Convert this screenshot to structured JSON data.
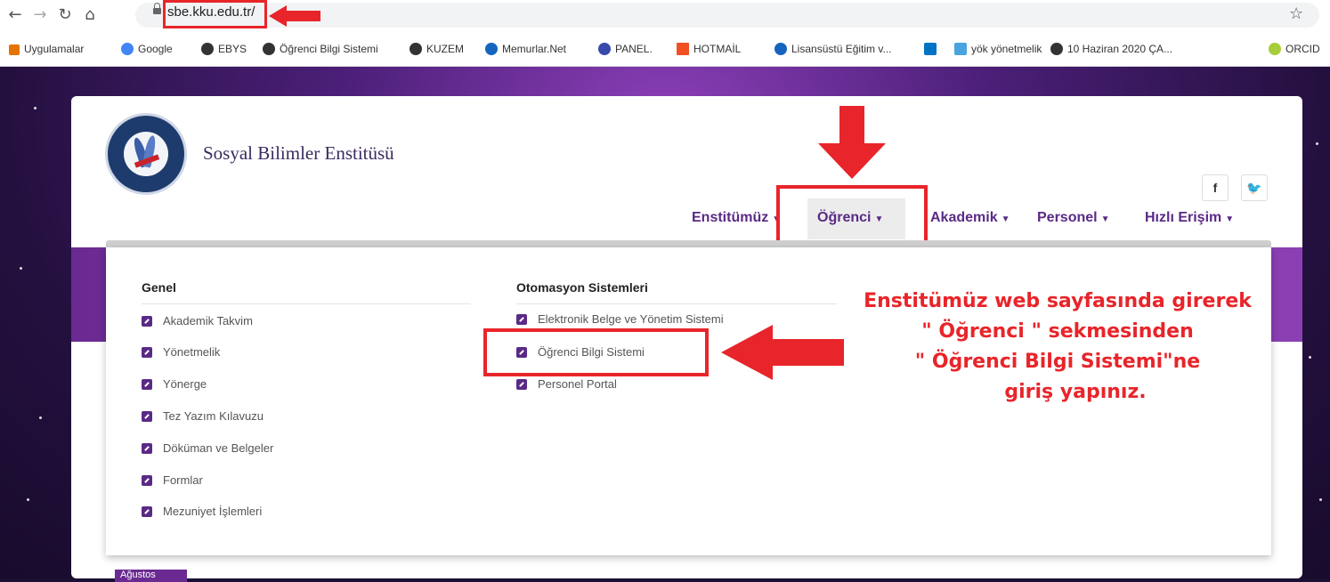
{
  "browser": {
    "url": "sbe.kku.edu.tr/",
    "bookmarks": [
      {
        "label": "Uygulamalar",
        "icon": "apps-grid-icon",
        "color": "#e37400"
      },
      {
        "label": "Google",
        "icon": "google-icon",
        "color": "#4285f4"
      },
      {
        "label": "EBYS",
        "icon": "globe-icon",
        "color": "#333333"
      },
      {
        "label": "Öğrenci Bilgi Sistemi",
        "icon": "globe-icon",
        "color": "#333333"
      },
      {
        "label": "KUZEM",
        "icon": "globe-icon",
        "color": "#333333"
      },
      {
        "label": "Memurlar.Net",
        "icon": "memurlar-icon",
        "color": "#1565c0"
      },
      {
        "label": "PANEL.",
        "icon": "panel-icon",
        "color": "#3949ab"
      },
      {
        "label": "HOTMAİL",
        "icon": "windows-icon",
        "color": "#f25022"
      },
      {
        "label": "Lisansüstü Eğitim v...",
        "icon": "memurlar-icon",
        "color": "#1565c0"
      },
      {
        "label": "",
        "icon": "outlook-icon",
        "color": "#0072c6"
      },
      {
        "label": "yök yönetmelik",
        "icon": "doc-icon",
        "color": "#4aa3df"
      },
      {
        "label": "10 Haziran 2020 ÇA...",
        "icon": "globe-icon",
        "color": "#333333"
      },
      {
        "label": "ORCID",
        "icon": "orcid-icon",
        "color": "#a6ce39"
      }
    ]
  },
  "site": {
    "title": "Sosyal Bilimler Enstitüsü",
    "social": [
      "f",
      "t"
    ],
    "menu": [
      {
        "label": "Enstitümüz"
      },
      {
        "label": "Öğrenci"
      },
      {
        "label": "Akademik"
      },
      {
        "label": "Personel"
      },
      {
        "label": "Hızlı Erişim"
      }
    ],
    "dropdown": {
      "col1_title": "Genel",
      "col1_links": [
        "Akademik Takvim",
        "Yönetmelik",
        "Yönerge",
        "Tez Yazım Kılavuzu",
        "Döküman ve Belgeler",
        "Formlar",
        "Mezuniyet İşlemleri"
      ],
      "col2_title": "Otomasyon Sistemleri",
      "col2_links": [
        "Elektronik Belge ve Yönetim Sistemi",
        "Öğrenci Bilgi Sistemi",
        "Personel Portal"
      ]
    },
    "bottom_tag": "Ağustos"
  },
  "annotation": {
    "line1": "Enstitümüz web sayfasında girerek",
    "line2": "\" Öğrenci \" sekmesinden",
    "line3": "\" Öğrenci Bilgi Sistemi\"ne",
    "line4": "giriş yapınız."
  },
  "colors": {
    "accent": "#5a2a86",
    "annotation": "#e8252a"
  }
}
